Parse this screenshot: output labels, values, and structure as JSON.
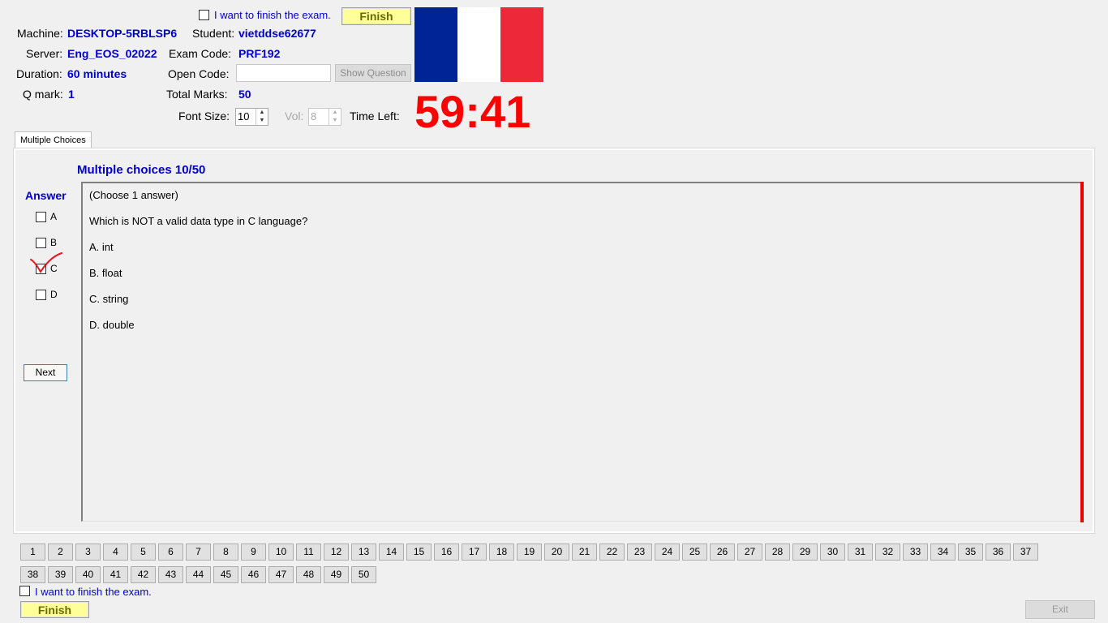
{
  "header": {
    "finish_checkbox_label": "I want to finish the exam.",
    "finish_button": "Finish",
    "machine_label": "Machine:",
    "machine_value": "DESKTOP-5RBLSP6",
    "student_label": "Student:",
    "student_value": "vietddse62677",
    "server_label": "Server:",
    "server_value": "Eng_EOS_02022",
    "exam_code_label": "Exam Code:",
    "exam_code_value": "PRF192",
    "duration_label": "Duration:",
    "duration_value": "60 minutes",
    "open_code_label": "Open Code:",
    "open_code_value": "",
    "show_question_button": "Show Question",
    "qmark_label": "Q mark:",
    "qmark_value": "1",
    "total_marks_label": "Total Marks:",
    "total_marks_value": "50",
    "font_size_label": "Font Size:",
    "font_size_value": "10",
    "vol_label": "Vol:",
    "vol_value": "8",
    "time_left_label": "Time Left:",
    "time_left_value": "59:41",
    "flag_colors": [
      "#002395",
      "#ffffff",
      "#ed2939"
    ]
  },
  "tab": {
    "label": "Multiple Choices"
  },
  "question": {
    "progress_title": "Multiple choices 10/50",
    "answer_title": "Answer",
    "answer_options": [
      {
        "key": "A",
        "checked": false
      },
      {
        "key": "B",
        "checked": false
      },
      {
        "key": "C",
        "checked": false
      },
      {
        "key": "D",
        "checked": false
      }
    ],
    "marked_option": "C",
    "next_button": "Next",
    "lines": [
      "(Choose 1 answer)",
      "Which is NOT a valid data type in C language?",
      "A.  int",
      "B.  float",
      "C.  string",
      "D.  double"
    ]
  },
  "question_nav": {
    "numbers": [
      "1",
      "2",
      "3",
      "4",
      "5",
      "6",
      "7",
      "8",
      "9",
      "10",
      "11",
      "12",
      "13",
      "14",
      "15",
      "16",
      "17",
      "18",
      "19",
      "20",
      "21",
      "22",
      "23",
      "24",
      "25",
      "26",
      "27",
      "28",
      "29",
      "30",
      "31",
      "32",
      "33",
      "34",
      "35",
      "36",
      "37",
      "38",
      "39",
      "40",
      "41",
      "42",
      "43",
      "44",
      "45",
      "46",
      "47",
      "48",
      "49",
      "50"
    ]
  },
  "footer": {
    "finish_checkbox_label": "I want to finish the exam.",
    "finish_button": "Finish",
    "exit_button": "Exit"
  }
}
